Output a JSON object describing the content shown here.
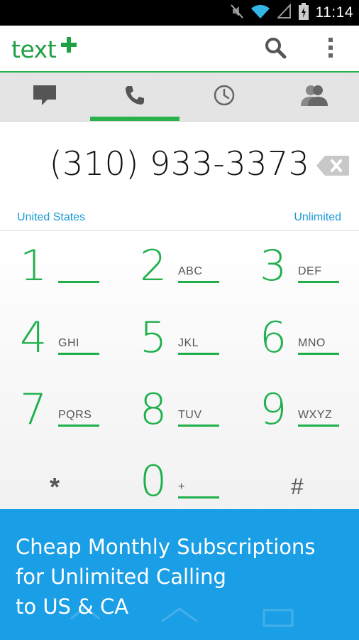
{
  "status_bar": {
    "time": "11:14",
    "icons": [
      "mute-icon",
      "wifi-icon",
      "signal-icon",
      "battery-charging-icon"
    ]
  },
  "app_bar": {
    "logo_text": "text",
    "logo_symbol": "+",
    "actions": [
      "search-icon",
      "overflow-menu-icon"
    ]
  },
  "tabs": [
    {
      "name": "messages",
      "icon": "chat-bubble-icon",
      "active": false
    },
    {
      "name": "calls",
      "icon": "phone-icon",
      "active": true
    },
    {
      "name": "history",
      "icon": "clock-icon",
      "active": false
    },
    {
      "name": "contacts",
      "icon": "contacts-icon",
      "active": false
    }
  ],
  "dialer": {
    "number": "(310) 933-3373",
    "country": "United States",
    "plan": "Unlimited"
  },
  "keypad": [
    {
      "digit": "1",
      "letters": ""
    },
    {
      "digit": "2",
      "letters": "ABC"
    },
    {
      "digit": "3",
      "letters": "DEF"
    },
    {
      "digit": "4",
      "letters": "GHI"
    },
    {
      "digit": "5",
      "letters": "JKL"
    },
    {
      "digit": "6",
      "letters": "MNO"
    },
    {
      "digit": "7",
      "letters": "PQRS"
    },
    {
      "digit": "8",
      "letters": "TUV"
    },
    {
      "digit": "9",
      "letters": "WXYZ"
    },
    {
      "digit": "*",
      "letters": ""
    },
    {
      "digit": "0",
      "letters": "+"
    },
    {
      "digit": "#",
      "letters": ""
    }
  ],
  "ad": {
    "line1": "Cheap Monthly Subscriptions",
    "line2": "for Unlimited Calling",
    "line3": "to US & CA"
  },
  "colors": {
    "brand_green": "#1fb04c",
    "link_blue": "#1a9ad6",
    "ad_blue": "#1a9ee5"
  }
}
